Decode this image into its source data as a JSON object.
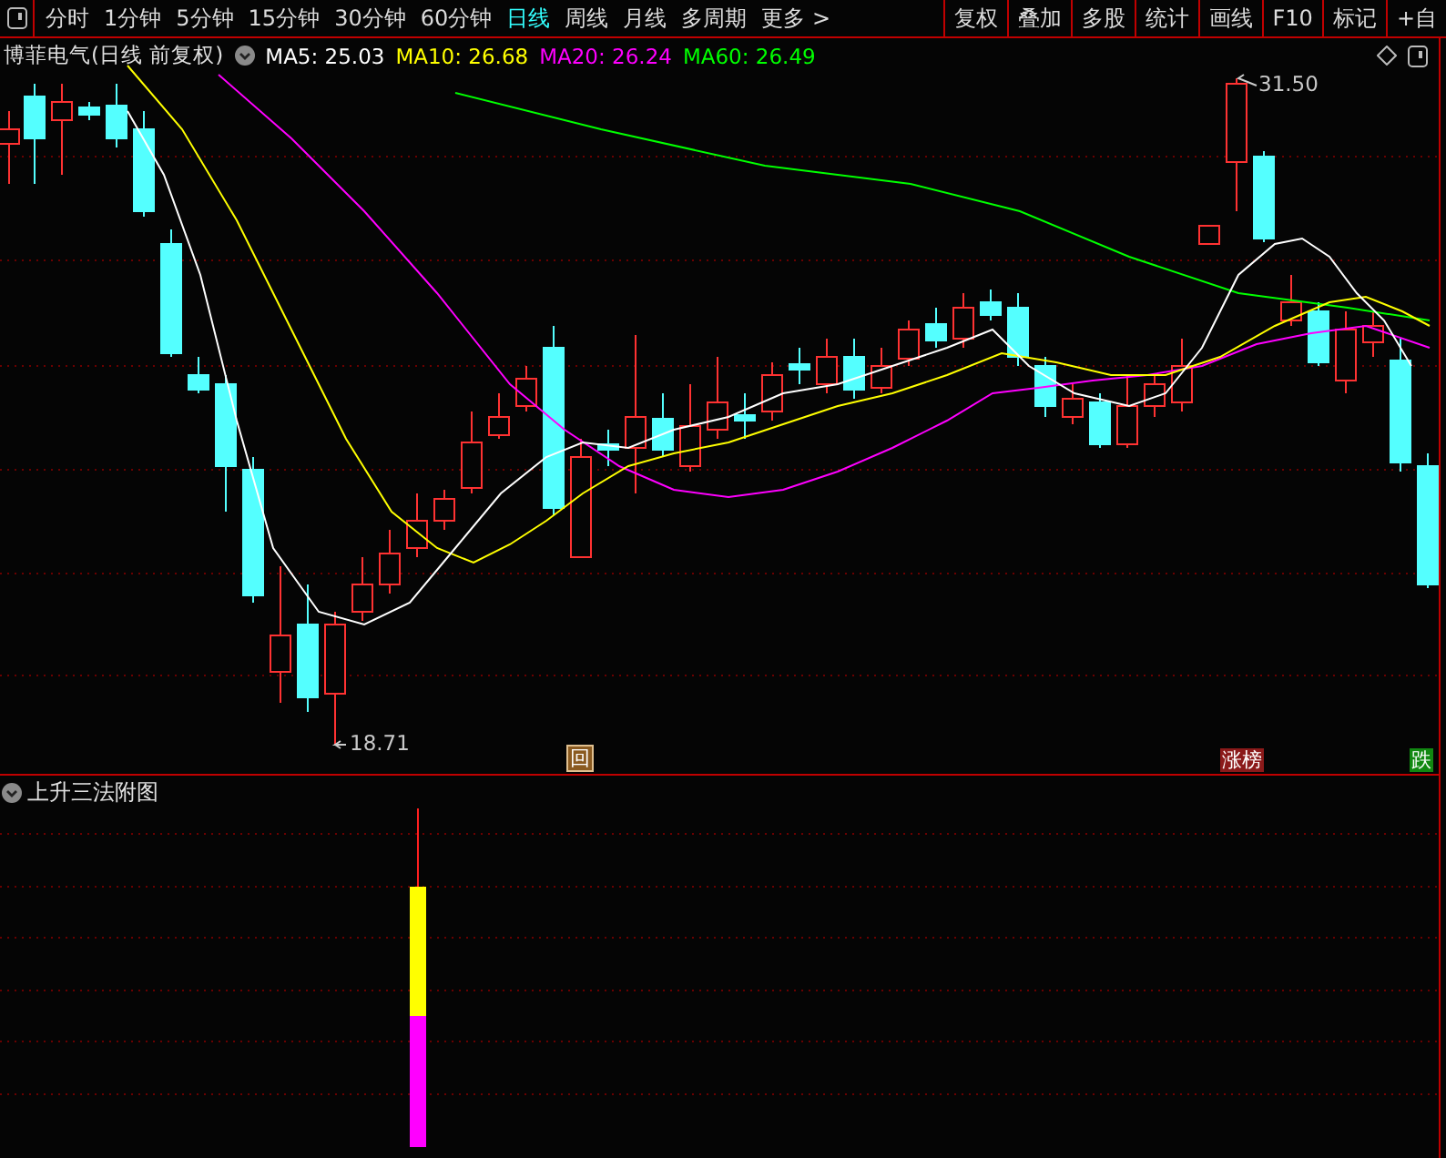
{
  "toolbar": {
    "periods": [
      {
        "label": "分时",
        "selected": false
      },
      {
        "label": "1分钟",
        "selected": false
      },
      {
        "label": "5分钟",
        "selected": false
      },
      {
        "label": "15分钟",
        "selected": false
      },
      {
        "label": "30分钟",
        "selected": false
      },
      {
        "label": "60分钟",
        "selected": false
      },
      {
        "label": "日线",
        "selected": true
      },
      {
        "label": "周线",
        "selected": false
      },
      {
        "label": "月线",
        "selected": false
      },
      {
        "label": "多周期",
        "selected": false
      },
      {
        "label": "更多 >",
        "selected": false
      }
    ],
    "tools": [
      "复权",
      "叠加",
      "多股",
      "统计",
      "画线",
      "F10",
      "标记",
      "+自"
    ]
  },
  "chart": {
    "title": "博菲电气(日线 前复权)",
    "indicators": [
      {
        "label": "MA5: 25.03",
        "color": "#ffffff"
      },
      {
        "label": "MA10: 26.68",
        "color": "#ffff00"
      },
      {
        "label": "MA20: 26.24",
        "color": "#ff00ff"
      },
      {
        "label": "MA60: 26.49",
        "color": "#00ff00"
      }
    ],
    "high_label": "31.50",
    "low_label": "18.71",
    "markers": [
      {
        "text": "回",
        "kind": "review"
      },
      {
        "text": "涨榜",
        "kind": "rise"
      },
      {
        "text": "跌",
        "kind": "fall"
      }
    ]
  },
  "subchart": {
    "title": "上升三法附图"
  }
}
